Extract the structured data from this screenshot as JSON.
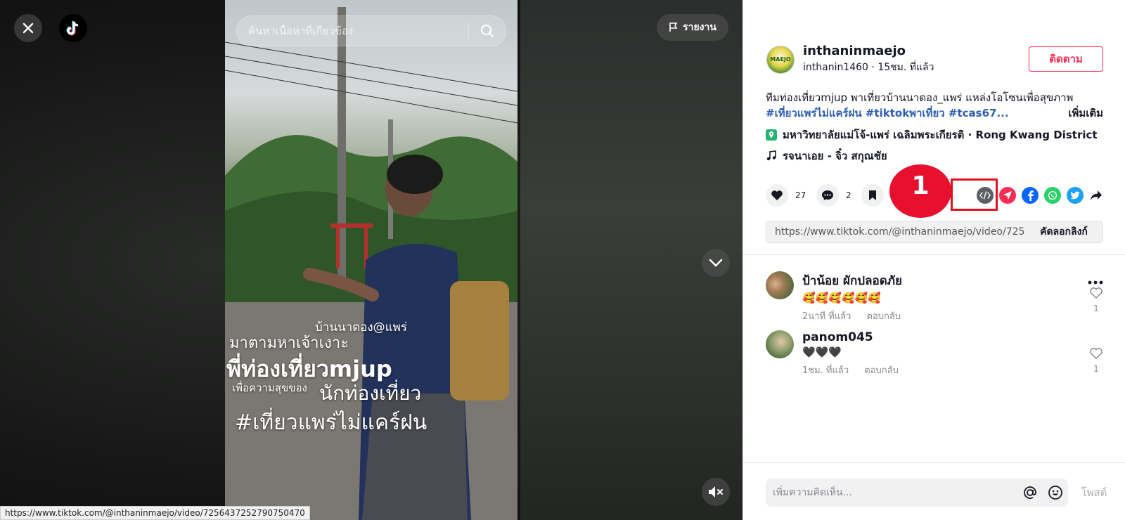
{
  "video_overlay": {
    "close_icon": "close-icon",
    "logo_icon": "tiktok-logo-icon",
    "search_placeholder": "ค้นหาเนื้อหาที่เกี่ยวข้อง",
    "report_label": "รายงาน",
    "caption_lines": [
      "บ้านนาตอง@แพร่",
      "มาตามหาเจ้าเงาะ",
      "พี่ท่องเที่ยวmjup",
      "เพื่อความสุขของ",
      "นักท่องเที่ยว",
      "#เที่ยวแพร่ไม่แคร์ฝน"
    ],
    "status_url": "https://www.tiktok.com/@inthaninmaejo/video/7256437252790750470"
  },
  "author": {
    "display_name": "inthaninmaejo",
    "meta": "inthanin1460 · 15ชม. ที่แล้ว",
    "avatar_text": "MAEJO",
    "follow_label": "ติดตาม"
  },
  "description": {
    "text": "ทีมท่องเที่ยวmjup พาเที่ยวบ้านนาตอง_แพร่ แหล่งโอโซนเพื่อสุขภาพ",
    "tags": "#เที่ยวแพร่ไม่แคร์ฝน #tiktokพาเที่ยว #tcas67...",
    "more_label": "เพิ่มเติม"
  },
  "location": "มหาวิทยาลัยแม่โจ้-แพร่ เฉลิมพระเกียรติ · Rong Kwang District",
  "music": "รจนาเอย - จิ๋ว สกุณชัย",
  "actions": {
    "likes": "27",
    "comments": "2",
    "annotation_number": "1"
  },
  "share": {
    "url": "https://www.tiktok.com/@inthaninmaejo/video/7256...",
    "copy_label": "คัดลอกลิงก์"
  },
  "comments": [
    {
      "name": "ป้าน้อย ผักปลอดภัย",
      "text": "🥰🥰🥰🥰🥰🥰",
      "time": "2นาที ที่แล้ว",
      "reply": "ตอบกลับ",
      "likes": "1"
    },
    {
      "name": "panom045",
      "text": "🖤🖤🖤",
      "time": "1ชม. ที่แล้ว",
      "reply": "ตอบกลับ",
      "likes": "1"
    }
  ],
  "comment_bar": {
    "placeholder": "เพิ่มความคิดเห็น...",
    "post_label": "โพสต์"
  },
  "colors": {
    "brand": "#fe2c55",
    "annotation": "#e8102f",
    "link": "#2b5db9"
  }
}
